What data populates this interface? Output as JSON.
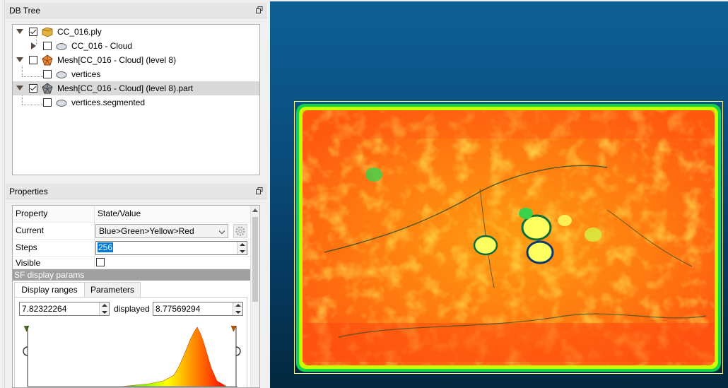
{
  "db_tree": {
    "title": "DB Tree",
    "items": [
      {
        "label": "CC_016.ply",
        "checked": true,
        "expanded": true,
        "icon": "folder-icon"
      },
      {
        "label": "CC_016 - Cloud",
        "checked": false,
        "expanded": false,
        "icon": "cloud-icon"
      },
      {
        "label": "Mesh[CC_016 - Cloud] (level 8)",
        "checked": false,
        "expanded": true,
        "icon": "mesh-icon"
      },
      {
        "label": "vertices",
        "checked": false,
        "icon": "cloud-icon"
      },
      {
        "label": "Mesh[CC_016 - Cloud] (level 8).part",
        "checked": true,
        "expanded": true,
        "icon": "mesh-icon",
        "selected": true
      },
      {
        "label": "vertices.segmented",
        "checked": false,
        "icon": "cloud-icon"
      }
    ]
  },
  "properties": {
    "title": "Properties",
    "header": {
      "property": "Property",
      "value": "State/Value"
    },
    "rows": {
      "current": {
        "label": "Current",
        "value": "Blue>Green>Yellow>Red"
      },
      "steps": {
        "label": "Steps",
        "value": "256"
      },
      "visible": {
        "label": "Visible",
        "checked": false
      }
    },
    "section": "SF display params",
    "tabs": [
      "Display ranges",
      "Parameters"
    ],
    "range": {
      "min": "7.82322264",
      "label": "displayed",
      "max": "8.77569294"
    }
  },
  "colors": {
    "selection": "#0078d7",
    "view_border": "#f7f77a",
    "scale": [
      "#0000ff",
      "#00ff00",
      "#ffff00",
      "#ff0000"
    ]
  }
}
